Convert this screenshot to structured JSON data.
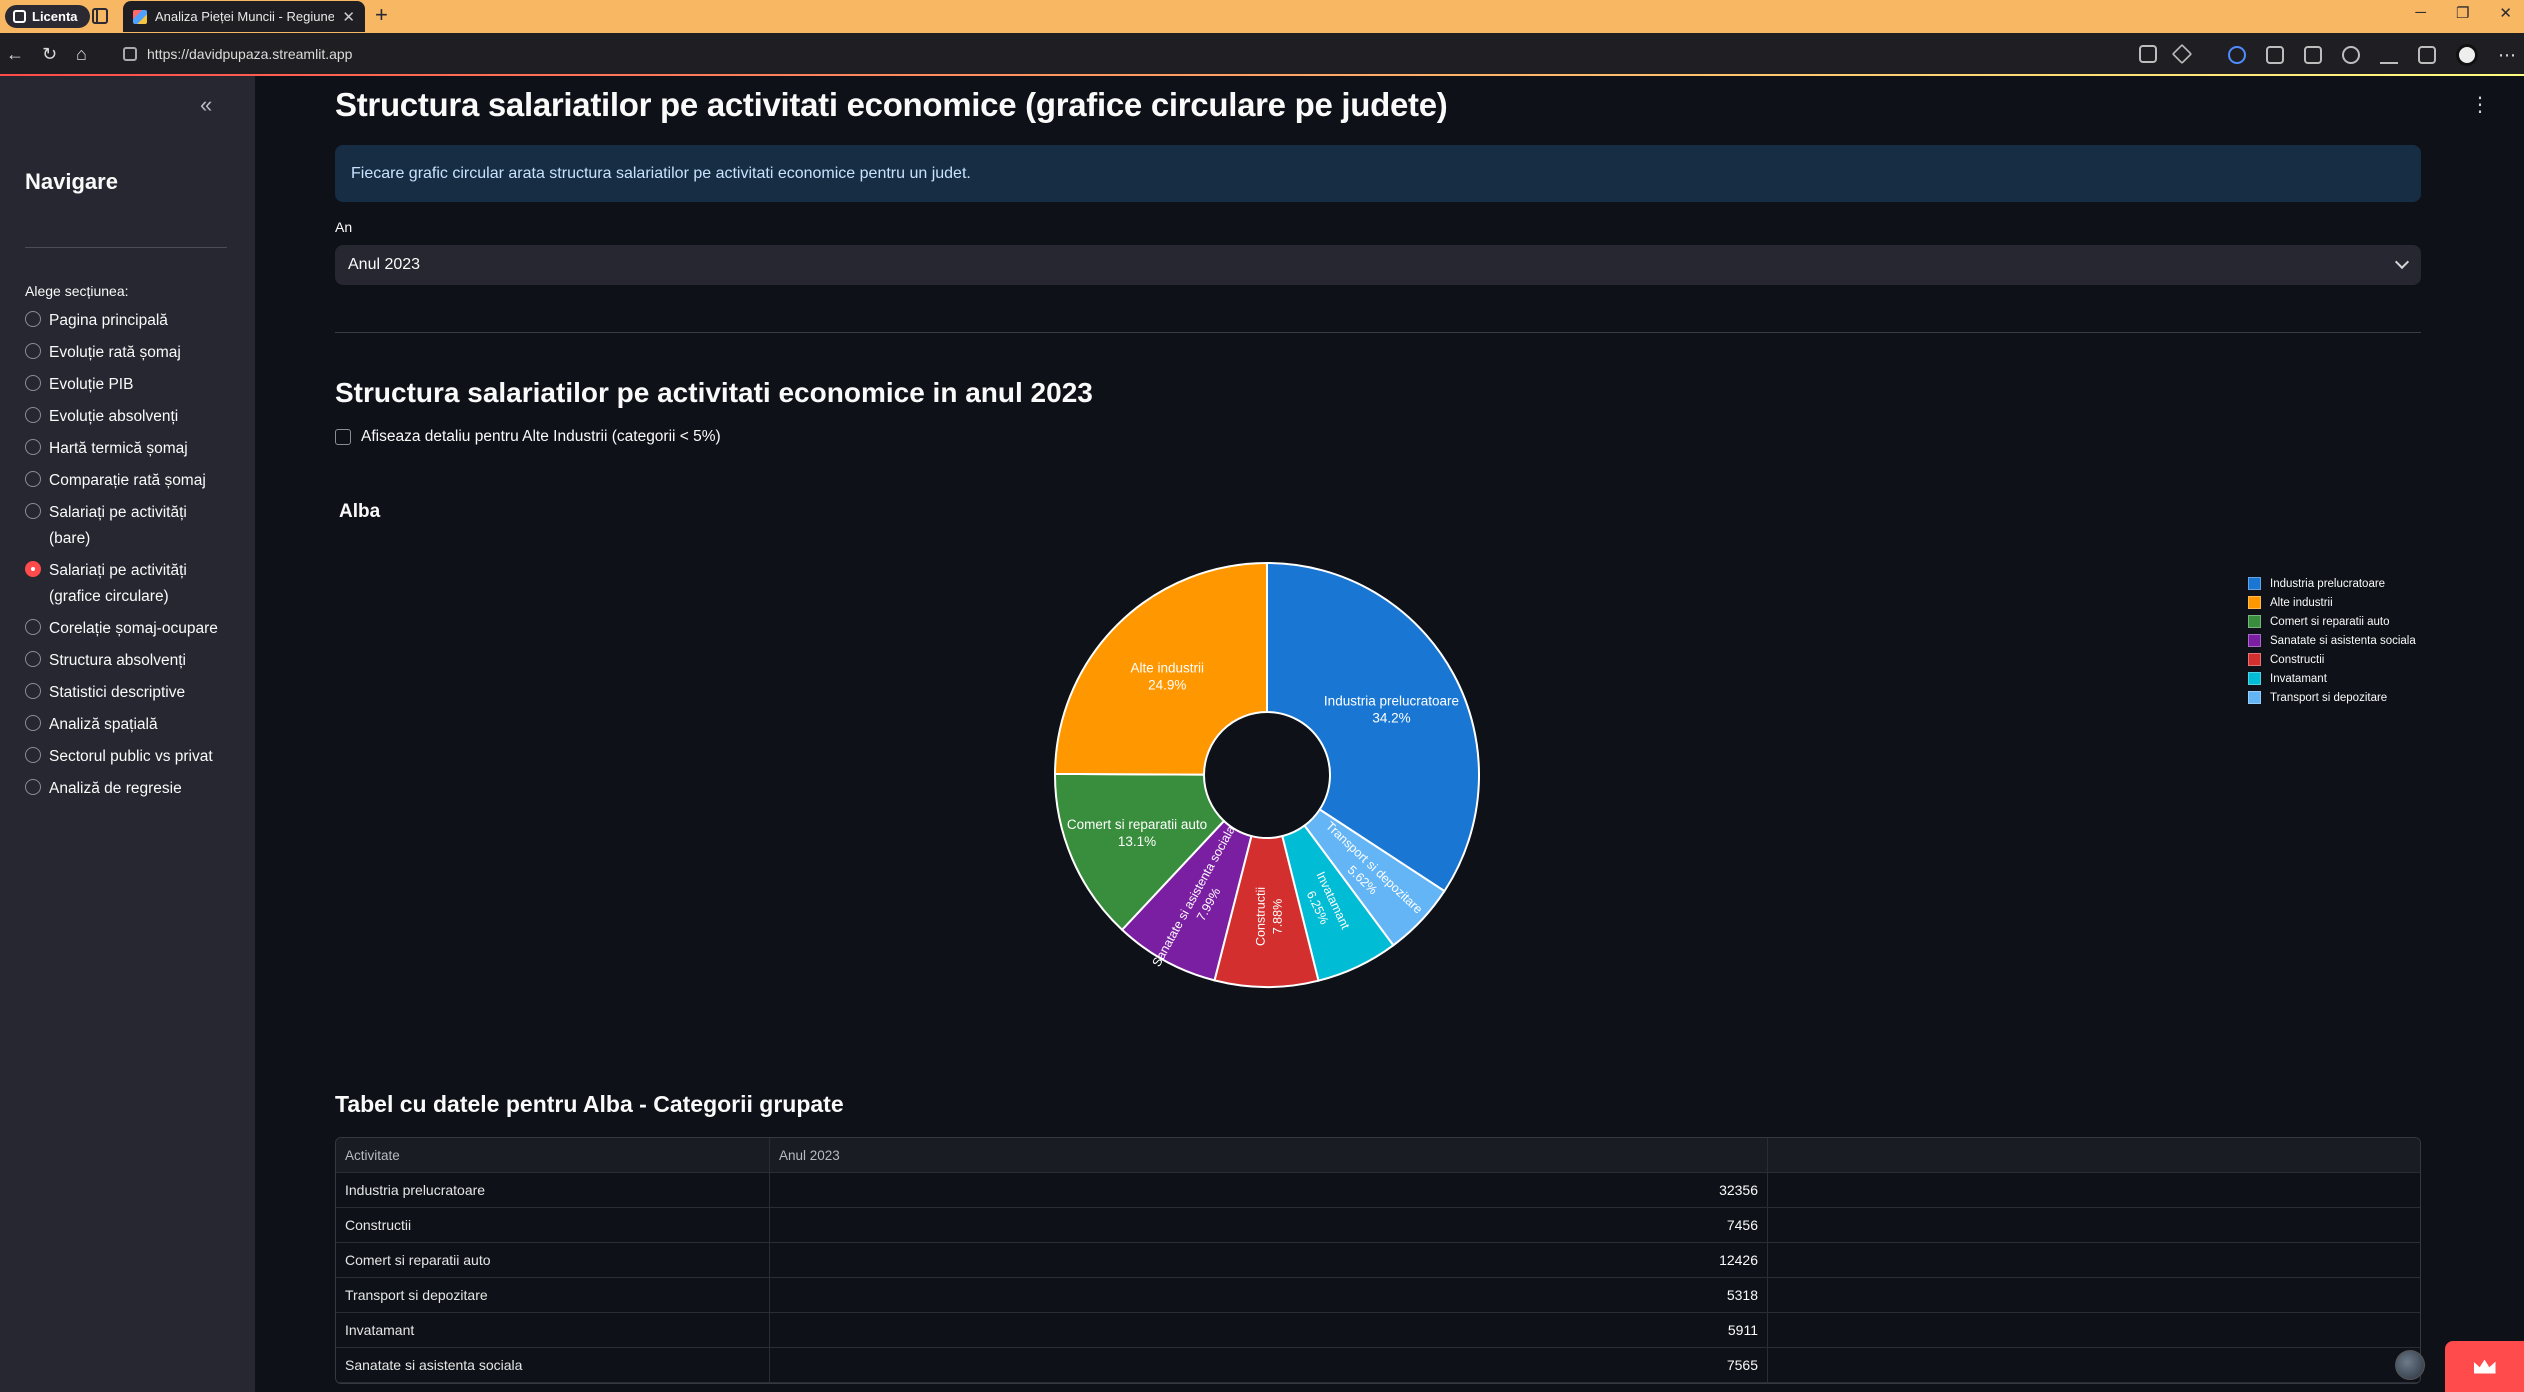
{
  "browser": {
    "profile_label": "Licenta",
    "tab_title": "Analiza Pieței Muncii - Regiunea C",
    "url": "https://davidpupaza.streamlit.app"
  },
  "sidebar": {
    "title": "Navigare",
    "radio_label": "Alege secțiunea:",
    "items": [
      {
        "label": "Pagina principală",
        "selected": false
      },
      {
        "label": "Evoluție rată șomaj",
        "selected": false
      },
      {
        "label": "Evoluție PIB",
        "selected": false
      },
      {
        "label": "Evoluție absolvenți",
        "selected": false
      },
      {
        "label": "Hartă termică șomaj",
        "selected": false
      },
      {
        "label": "Comparație rată șomaj",
        "selected": false
      },
      {
        "label": "Salariați pe activități (bare)",
        "selected": false
      },
      {
        "label": "Salariați pe activități (grafice circulare)",
        "selected": true
      },
      {
        "label": "Corelație șomaj-ocupare",
        "selected": false
      },
      {
        "label": "Structura absolvenți",
        "selected": false
      },
      {
        "label": "Statistici descriptive",
        "selected": false
      },
      {
        "label": "Analiză spațială",
        "selected": false
      },
      {
        "label": "Sectorul public vs privat",
        "selected": false
      },
      {
        "label": "Analiză de regresie",
        "selected": false
      }
    ]
  },
  "main": {
    "page_title": "Structura salariatilor pe activitati economice (grafice circulare pe judete)",
    "info_text": "Fiecare grafic circular arata structura salariatilor pe activitati economice pentru un judet.",
    "select_label": "An",
    "select_value": "Anul 2023",
    "section_title": "Structura salariatilor pe activitati economice in anul 2023",
    "checkbox_label": "Afiseaza detaliu pentru Alte Industrii (categorii < 5%)",
    "checkbox_checked": false,
    "table_title": "Tabel cu datele pentru Alba - Categorii grupate",
    "table": {
      "headers": [
        "Activitate",
        "Anul 2023"
      ],
      "rows": [
        [
          "Industria prelucratoare",
          "32356"
        ],
        [
          "Constructii",
          "7456"
        ],
        [
          "Comert si reparatii auto",
          "12426"
        ],
        [
          "Transport si depozitare",
          "5318"
        ],
        [
          "Invatamant",
          "5911"
        ],
        [
          "Sanatate si asistenta sociala",
          "7565"
        ]
      ]
    }
  },
  "chart_data": {
    "type": "pie",
    "title": "Alba",
    "donut": true,
    "legend_position": "top-right",
    "slices": [
      {
        "label": "Industria prelucratoare",
        "value": 34.2,
        "text": "34.2%",
        "color": "#1976d2"
      },
      {
        "label": "Transport si depozitare",
        "value": 5.62,
        "text": "5.62%",
        "color": "#64b5f6"
      },
      {
        "label": "Invatamant",
        "value": 6.25,
        "text": "6.25%",
        "color": "#00bcd4"
      },
      {
        "label": "Constructii",
        "value": 7.88,
        "text": "7.88%",
        "color": "#d32f2f"
      },
      {
        "label": "Sanatate si asistenta sociala",
        "value": 7.99,
        "text": "7.99%",
        "color": "#7b1fa2"
      },
      {
        "label": "Comert si reparatii auto",
        "value": 13.1,
        "text": "13.1%",
        "color": "#388e3c"
      },
      {
        "label": "Alte industrii",
        "value": 24.9,
        "text": "24.9%",
        "color": "#ff9800"
      }
    ],
    "legend": [
      {
        "label": "Industria prelucratoare",
        "color": "#1976d2"
      },
      {
        "label": "Alte industrii",
        "color": "#ff9800"
      },
      {
        "label": "Comert si reparatii auto",
        "color": "#388e3c"
      },
      {
        "label": "Sanatate si asistenta sociala",
        "color": "#7b1fa2"
      },
      {
        "label": "Constructii",
        "color": "#d32f2f"
      },
      {
        "label": "Invatamant",
        "color": "#00bcd4"
      },
      {
        "label": "Transport si depozitare",
        "color": "#64b5f6"
      }
    ]
  }
}
